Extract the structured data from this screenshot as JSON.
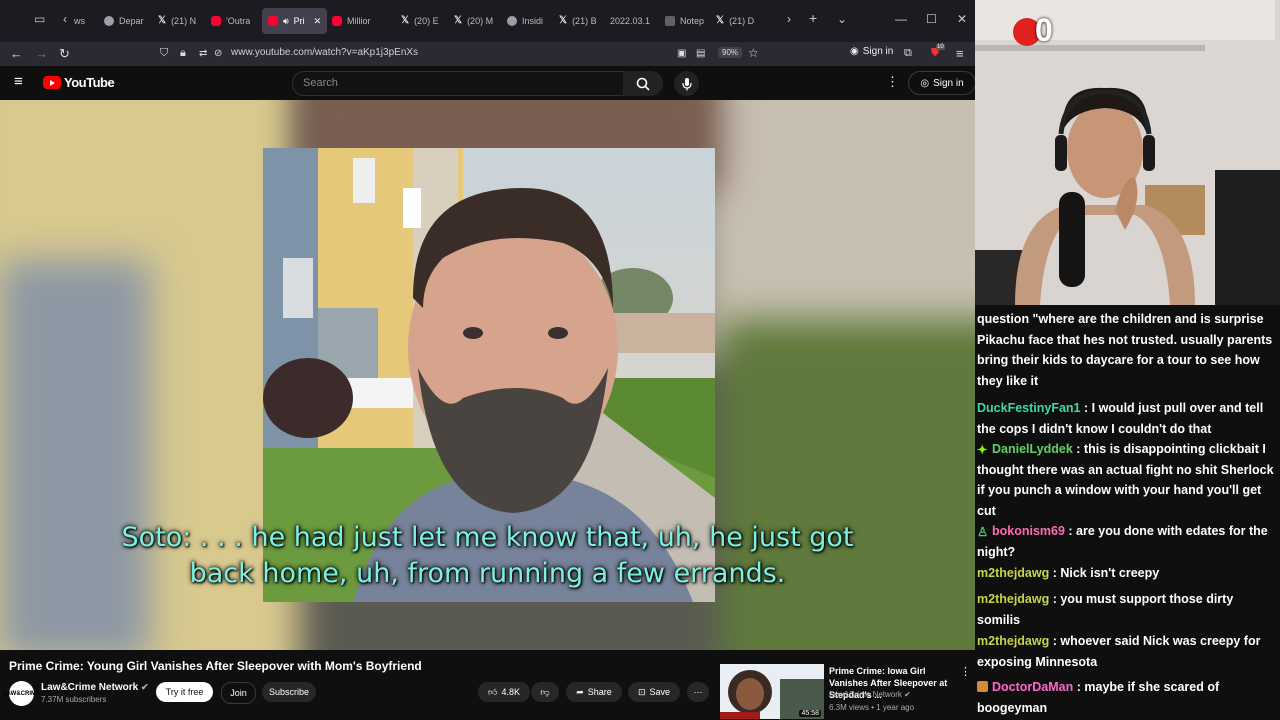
{
  "browser": {
    "tabs": [
      {
        "label": "ws",
        "icon": "none"
      },
      {
        "label": "Depar",
        "icon": "globe"
      },
      {
        "label": "(21) N",
        "icon": "x"
      },
      {
        "label": "'Outra",
        "icon": "youtube"
      },
      {
        "label": "Pri",
        "icon": "youtube",
        "active": true
      },
      {
        "label": "Millior",
        "icon": "youtube"
      },
      {
        "label": "(20) E",
        "icon": "x"
      },
      {
        "label": "(20) M",
        "icon": "x"
      },
      {
        "label": "Insidi",
        "icon": "globe"
      },
      {
        "label": "(21) B",
        "icon": "x"
      },
      {
        "label": "2022.03.1",
        "icon": "none"
      },
      {
        "label": "Notep",
        "icon": "note"
      },
      {
        "label": "(21) D",
        "icon": "x"
      }
    ],
    "url": "www.youtube.com/watch?v=aKp1j3pEnXs",
    "zoom": "90%",
    "sign_in": "Sign in",
    "badge_count": "10"
  },
  "youtube": {
    "logo_text": "YouTube",
    "search_placeholder": "Search",
    "sign_in": "Sign in"
  },
  "video": {
    "caption_line1": "Soto: . . . he had just let me know that, uh, he just got",
    "caption_line2": "back home, uh, from running a few errands."
  },
  "below_video": {
    "title": "Prime Crime: Young Girl Vanishes After Sleepover with Mom's Boyfriend",
    "channel": {
      "name": "Law&Crime Network",
      "subscribers": "7.37M subscribers",
      "avatar_text": "LAW&CRIME"
    },
    "try_it_free": "Try it free",
    "join": "Join",
    "subscribe": "Subscribe",
    "likes": "4.8K",
    "share": "Share",
    "save": "Save"
  },
  "sidebar_video": {
    "title": "Prime Crime: Iowa Girl Vanishes After Sleepover at Stepdad's ...",
    "channel": "Law&Crime Network",
    "meta": "6.3M views • 1 year ago",
    "duration": "45:58"
  },
  "stream": {
    "counter": "0"
  },
  "chat": [
    {
      "user": "",
      "color": "#ffffff",
      "text": "question \"where are the children and is surprise Pikachu face that hes not trusted. usually parents bring their kids to daycare for a tour to see how they like it",
      "badge": "none"
    },
    {
      "user": "DuckFestinyFan1",
      "color": "#3fd9a0",
      "text": "I would just pull over and tell the cops I didn't know I couldn't do that",
      "badge": "none"
    },
    {
      "user": "DanielLyddek",
      "color": "#5fd35f",
      "text": "this is disappointing clickbait I thought there was an actual fight no shit Sherlock if you punch a window with your hand you'll get cut",
      "badge": "sparkle"
    },
    {
      "user": "bokonism69",
      "color": "#ff69b4",
      "text": "are you done with edates for the night?",
      "badge": "person"
    },
    {
      "user": "m2thejdawg",
      "color": "#c8d44a",
      "text": "Nick isn't creepy",
      "badge": "none"
    },
    {
      "user": "m2thejdawg",
      "color": "#c8d44a",
      "text": "you must support those dirty somilis",
      "badge": "none"
    },
    {
      "user": "m2thejdawg",
      "color": "#c8d44a",
      "text": "whoever said Nick was creepy for exposing Minnesota",
      "badge": "none"
    },
    {
      "user": "DoctorDaMan",
      "color": "#ff66cc",
      "text": "maybe if she scared of boogeyman",
      "badge": "emote"
    }
  ]
}
